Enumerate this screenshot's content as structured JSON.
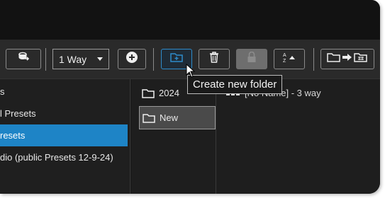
{
  "toolbar": {
    "direction_select": {
      "value": "1 Way"
    },
    "buttons": [
      "layers-swap-icon",
      "add-circle-icon",
      "new-folder-icon",
      "trash-icon",
      "lock-icon",
      "sort-az-icon",
      "move-to-folder-icon"
    ],
    "highlight_color": "#2e8ccc"
  },
  "tooltip": {
    "text": "Create new folder"
  },
  "left_panel": {
    "items": [
      {
        "label": "s"
      },
      {
        "label": "l Presets"
      },
      {
        "label": "resets",
        "selected": true
      },
      {
        "label": "dio (public Presets 12-9-24)"
      }
    ],
    "selected_color": "#1e84c6"
  },
  "folders": {
    "items": [
      {
        "label": "2024"
      },
      {
        "label": "New",
        "selected": true
      }
    ]
  },
  "presets": {
    "items": [
      {
        "label": "[No Name] - 3 way"
      }
    ]
  }
}
